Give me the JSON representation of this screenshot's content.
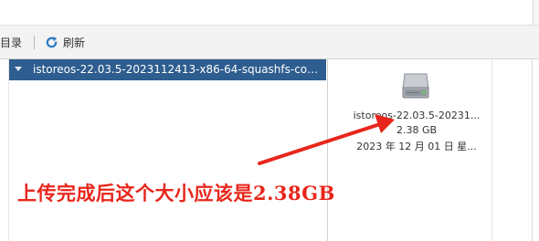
{
  "toolbar": {
    "directory_label": "目录",
    "refresh_label": "刷新",
    "refresh_icon": "refresh-icon"
  },
  "tree": {
    "selected_item": "istoreos-22.03.5-2023112413-x86-64-squashfs-combin..."
  },
  "file": {
    "icon": "hard-disk-icon",
    "name": "istoreos-22.03.5-20231...",
    "size": "2.38 GB",
    "date": "2023 年 12 月 01 日 星..."
  },
  "annotation": {
    "text": "上传完成后这个大小应该是2.38GB",
    "color": "#e8261c"
  },
  "colors": {
    "selection": "#2e5d8f",
    "refresh_icon": "#2f79c9",
    "toolbar_bg": "#f3f3f3"
  }
}
